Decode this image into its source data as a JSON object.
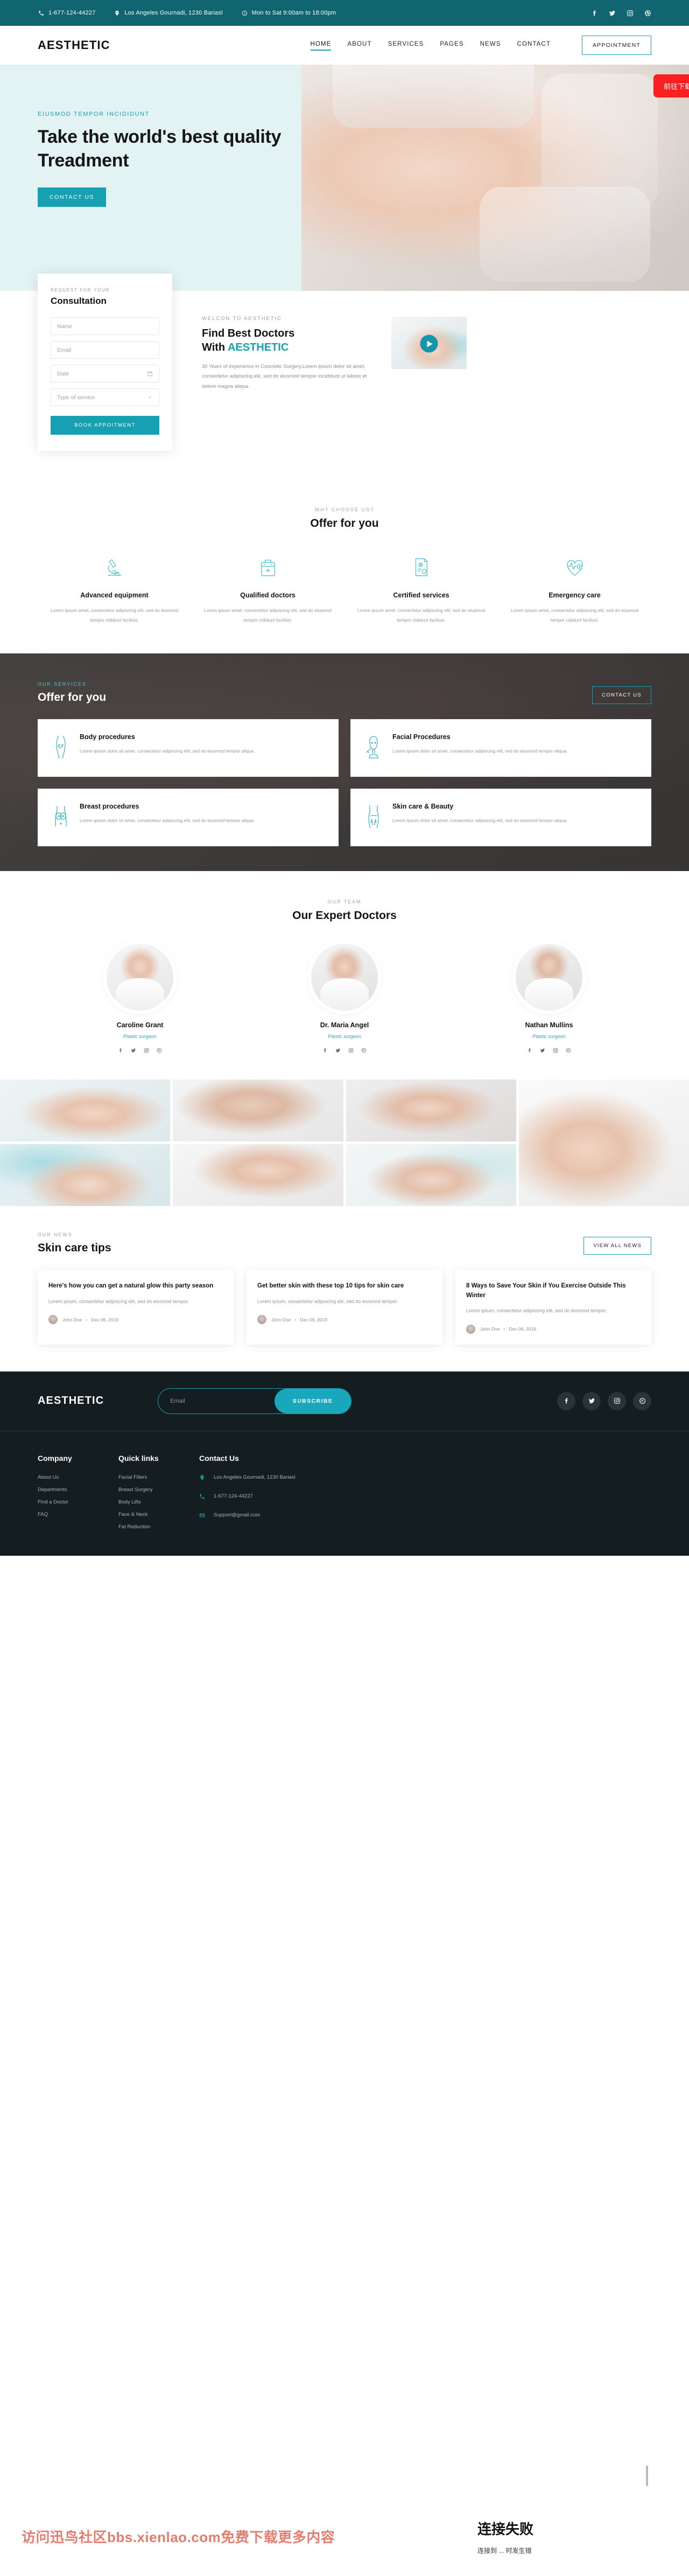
{
  "topbar": {
    "phone": "1-677-124-44227",
    "address": "Los Angeles Gournadi, 1230 Bariasl",
    "hours": "Mon to Sat 9:00am to 18:00pm",
    "social": [
      "facebook",
      "twitter",
      "instagram",
      "dribbble"
    ]
  },
  "nav": {
    "logo": "AESTHETIC",
    "items": [
      {
        "label": "HOME",
        "active": true
      },
      {
        "label": "ABOUT",
        "active": false
      },
      {
        "label": "SERVICES",
        "active": false
      },
      {
        "label": "PAGES",
        "active": false
      },
      {
        "label": "NEWS",
        "active": false
      },
      {
        "label": "CONTACT",
        "active": false
      }
    ],
    "appointment_label": "APPOINTMENT"
  },
  "hero": {
    "eyebrow": "EIUSMOD TEMPOR INCIDIDUNT",
    "title": "Take the world's best quality Treadment",
    "cta": "CONTACT US"
  },
  "consultation": {
    "eyebrow": "REQUEST FOR YOUR",
    "title": "Consultation",
    "name_placeholder": "Name",
    "email_placeholder": "Email",
    "date_placeholder": "Date",
    "service_placeholder": "Type of service",
    "submit_label": "BOOK APPOITMENT"
  },
  "about": {
    "eyebrow": "WELCON TO AESTHETIC",
    "title_part1": "Find Best Doctors",
    "title_part2": "With ",
    "title_accent": "AESTHETIC",
    "paragraph": "30 Years of experience in Cosmetic Surgery.Lorem ipsum dolor sit amet, consectetur adipiscing elit, sed do eiusmod tempor incididunt ut labore et dolore magna aliqua."
  },
  "why": {
    "eyebrow": "WHY CHOOSE US?",
    "title": "Offer for you",
    "items": [
      {
        "icon": "microscope-icon",
        "name": "Advanced equipment",
        "desc": "Lorem ipsum amet, consectetur adipiscing elit, sed do eiusmod tempor cididunt facilisis."
      },
      {
        "icon": "medical-bag-icon",
        "name": "Qualified doctors",
        "desc": "Lorem ipsum amet, consectetur adipiscing elit, sed do eiusmod tempor cididunt facilisis."
      },
      {
        "icon": "certificate-icon",
        "name": "Certified services",
        "desc": "Lorem ipsum amet, consectetur adipiscing elit, sed do eiusmod tempor cididunt facilisis."
      },
      {
        "icon": "heartbeat-icon",
        "name": "Emergency care",
        "desc": "Lorem ipsum amet, consectetur adipiscing elit, sed do eiusmod tempor cididunt facilisis."
      }
    ]
  },
  "services": {
    "eyebrow": "OUR SERVICES",
    "title": "Offer for you",
    "cta": "CONTACT US",
    "items": [
      {
        "icon": "body-icon",
        "name": "Body procedures",
        "desc": "Lorem ipsum dolor sit amet, consectetur adipiscing elit, sed do eiusmod tempor aliqua."
      },
      {
        "icon": "face-icon",
        "name": "Facial Procedures",
        "desc": "Lorem ipsum dolor sit amet, consectetur adipiscing elit, sed do eiusmod tempor aliqua."
      },
      {
        "icon": "breast-icon",
        "name": "Breast procedures",
        "desc": "Lorem ipsum dolor sit amet, consectetur adipiscing elit, sed do eiusmod tempor aliqua."
      },
      {
        "icon": "skincare-icon",
        "name": "Skin care & Beauty",
        "desc": "Lorem ipsum dolor sit amet, consectetur adipiscing elit, sed do eiusmod tempor aliqua."
      }
    ]
  },
  "team": {
    "eyebrow": "OUR TEAM",
    "title": "Our Expert Doctors",
    "members": [
      {
        "name": "Caroline Grant",
        "role": "Plastic surgeon"
      },
      {
        "name": "Dr. Maria Angel",
        "role": "Plastic surgeon"
      },
      {
        "name": "Nathan Mullins",
        "role": "Plastic surgeon"
      }
    ]
  },
  "gallery": {
    "images": [
      "facial-massage-photo",
      "senior-woman-photo",
      "woman-red-nails-photo",
      "body-contour-photo",
      "injection-photo",
      "breast-implant-photo",
      "skin-treatment-photo"
    ]
  },
  "news": {
    "eyebrow": "OUR NEWS",
    "title": "Skin care tips",
    "cta": "VIEW ALL NEWS",
    "posts": [
      {
        "title": "Here's how you can get a natural glow this party season",
        "desc": "Lorem ipsum, consectetur adipiscing elit, sed do eiusmod tempor.",
        "author": "John Doe",
        "date": "Dec 06, 2019"
      },
      {
        "title": "Get better skin with these top 10 tips for skin care",
        "desc": "Lorem ipsum, consectetur adipiscing elit, sed do eiusmod tempor.",
        "author": "John Doe",
        "date": "Dec 06, 2019"
      },
      {
        "title": "8 Ways to Save Your Skin if You Exercise Outside This Winter",
        "desc": "Lorem ipsum, consectetur adipiscing elit, sed do eiusmod tempor.",
        "author": "John Doe",
        "date": "Dec 06, 2019"
      }
    ]
  },
  "footer": {
    "logo": "AESTHETIC",
    "email_placeholder": "Email",
    "subscribe_label": "SUBSCRIBE",
    "social": [
      "facebook",
      "twitter",
      "instagram",
      "dribbble"
    ],
    "company": {
      "heading": "Company",
      "links": [
        "About Us",
        "Departments",
        "Find a Doctor",
        "FAQ"
      ]
    },
    "quick_links": {
      "heading": "Quick links",
      "links": [
        "Facial Fillers",
        "Breast Surgery",
        "Body Lifts",
        "Face & Neck",
        "Fat Reduction"
      ]
    },
    "contact": {
      "heading": "Contact Us",
      "address": "Los Angeles Gournadi, 1230 Bariasl",
      "phone": "1-677-124-44227",
      "email": "Support@gmail.com"
    }
  },
  "overlay": {
    "title": "连接失败",
    "subtitle": "连接到 ... 时发生错",
    "button": "前往下载模板",
    "watermark": "访问迅鸟社区bbs.xienlao.com免费下载更多内容"
  },
  "colors": {
    "teal_dark": "#116570",
    "teal": "#16a0b2",
    "hero_bg": "#e3f2f2",
    "footer_bg": "#141d1f",
    "red": "#fb2020"
  }
}
